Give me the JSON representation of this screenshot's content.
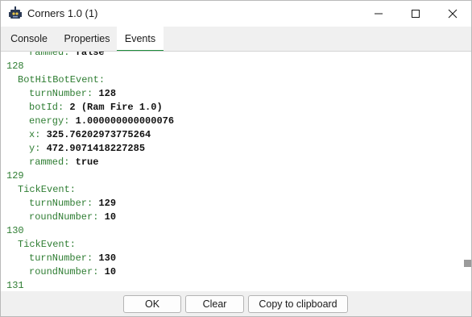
{
  "window": {
    "title": "Corners 1.0 (1)"
  },
  "tabs": [
    {
      "label": "Console",
      "active": false
    },
    {
      "label": "Properties",
      "active": false
    },
    {
      "label": "Events",
      "active": true
    }
  ],
  "events_log": [
    {
      "indent": 2,
      "key": "rammed:",
      "value": "false"
    },
    {
      "indent": 0,
      "turn": "128"
    },
    {
      "indent": 1,
      "key": "BotHitBotEvent:"
    },
    {
      "indent": 2,
      "key": "turnNumber:",
      "value": "128"
    },
    {
      "indent": 2,
      "key": "botId:",
      "value": "2 (Ram Fire 1.0)"
    },
    {
      "indent": 2,
      "key": "energy:",
      "value": "1.000000000000076"
    },
    {
      "indent": 2,
      "key": "x:",
      "value": "325.76202973775264"
    },
    {
      "indent": 2,
      "key": "y:",
      "value": "472.9071418227285"
    },
    {
      "indent": 2,
      "key": "rammed:",
      "value": "true"
    },
    {
      "indent": 0,
      "turn": "129"
    },
    {
      "indent": 1,
      "key": "TickEvent:"
    },
    {
      "indent": 2,
      "key": "turnNumber:",
      "value": "129"
    },
    {
      "indent": 2,
      "key": "roundNumber:",
      "value": "10"
    },
    {
      "indent": 0,
      "turn": "130"
    },
    {
      "indent": 1,
      "key": "TickEvent:"
    },
    {
      "indent": 2,
      "key": "turnNumber:",
      "value": "130"
    },
    {
      "indent": 2,
      "key": "roundNumber:",
      "value": "10"
    },
    {
      "indent": 0,
      "turn": "131"
    }
  ],
  "buttons": {
    "ok": "OK",
    "clear": "Clear",
    "copy": "Copy to clipboard"
  },
  "colors": {
    "accent": "#1e8c3c",
    "key_text": "#2e7d32"
  }
}
